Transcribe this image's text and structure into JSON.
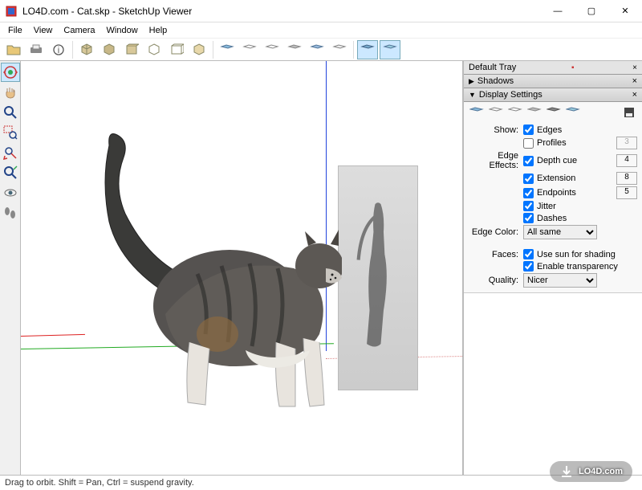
{
  "window": {
    "title": "LO4D.com - Cat.skp - SketchUp Viewer",
    "min": "—",
    "max": "▢",
    "close": "✕"
  },
  "menu": {
    "file": "File",
    "view": "View",
    "camera": "Camera",
    "window": "Window",
    "help": "Help"
  },
  "tray": {
    "title": "Default Tray",
    "shadows": "Shadows",
    "display": "Display Settings"
  },
  "display": {
    "show_label": "Show:",
    "edges": "Edges",
    "profiles": "Profiles",
    "profiles_value": "3",
    "edge_effects_label": "Edge Effects:",
    "depth_cue": "Depth cue",
    "depth_cue_value": "4",
    "extension": "Extension",
    "extension_value": "8",
    "endpoints": "Endpoints",
    "endpoints_value": "5",
    "jitter": "Jitter",
    "dashes": "Dashes",
    "edge_color_label": "Edge Color:",
    "edge_color_value": "All same",
    "faces_label": "Faces:",
    "use_sun": "Use sun for shading",
    "enable_transparency": "Enable transparency",
    "quality_label": "Quality:",
    "quality_value": "Nicer"
  },
  "statusbar": {
    "text": "Drag to orbit. Shift = Pan, Ctrl = suspend gravity."
  },
  "watermark": "LO4D.com"
}
